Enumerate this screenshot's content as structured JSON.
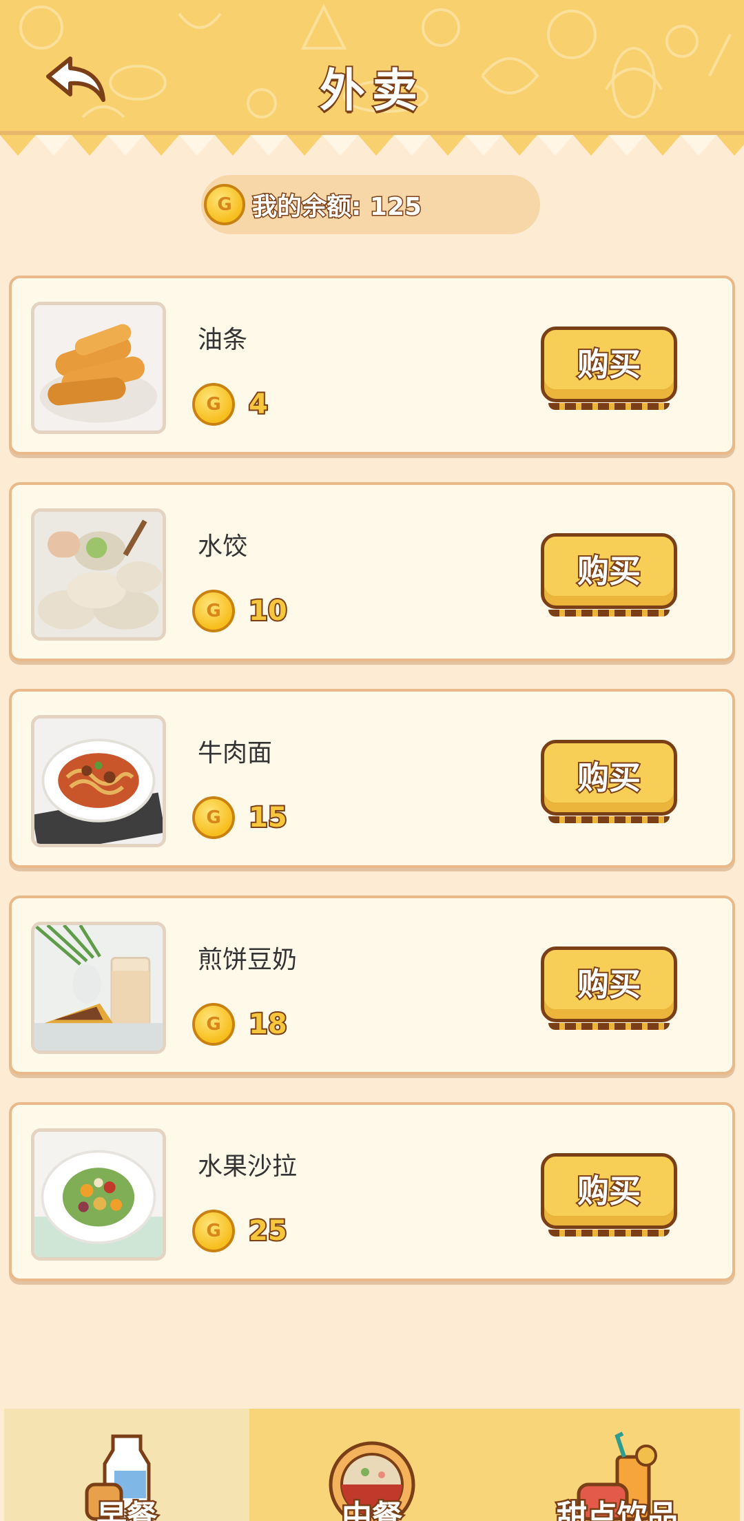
{
  "header": {
    "title": "外卖"
  },
  "balance": {
    "coin_letter": "G",
    "text": "我的余额: 125"
  },
  "items": [
    {
      "name": "油条",
      "price": "4",
      "buy_label": "购买",
      "coin_letter": "G"
    },
    {
      "name": "水饺",
      "price": "10",
      "buy_label": "购买",
      "coin_letter": "G"
    },
    {
      "name": "牛肉面",
      "price": "15",
      "buy_label": "购买",
      "coin_letter": "G"
    },
    {
      "name": "煎饼豆奶",
      "price": "18",
      "buy_label": "购买",
      "coin_letter": "G"
    },
    {
      "name": "水果沙拉",
      "price": "25",
      "buy_label": "购买",
      "coin_letter": "G"
    }
  ],
  "tabs": [
    {
      "label": "早餐",
      "icon": "milk-bread-icon",
      "active": true
    },
    {
      "label": "中餐",
      "icon": "hotpot-icon",
      "active": false
    },
    {
      "label": "甜点饮品",
      "icon": "cake-drink-icon",
      "active": false
    }
  ],
  "colors": {
    "background": "#fdebd4",
    "header": "#f9d06e",
    "button": "#f8cf56",
    "outline": "#7a3f16",
    "coin": "#f7be1d"
  }
}
